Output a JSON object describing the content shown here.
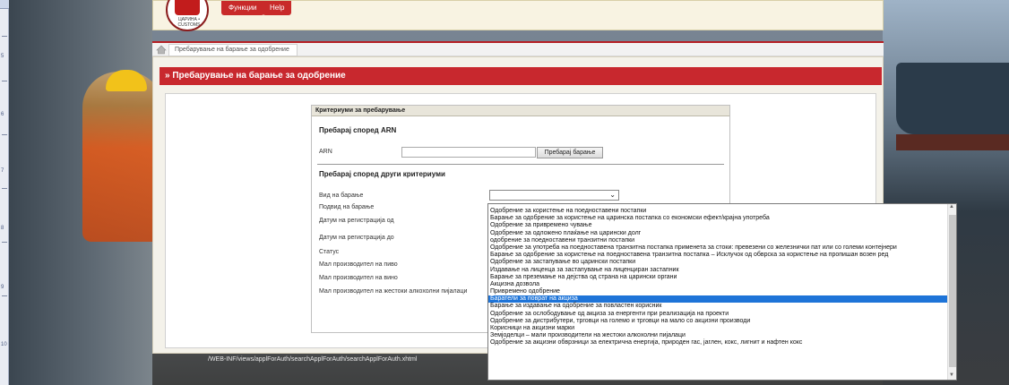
{
  "header": {
    "logo_text": "ЦАРИНА • CUSTOMS",
    "buttons": [
      "Функции",
      "Help"
    ]
  },
  "breadcrumb": {
    "current": "Пребарување на барање за одобрение"
  },
  "page_title": "» Пребарување на барање за одобрение",
  "form": {
    "header": "Критериуми за пребарување",
    "section_arn": "Пребарај според ARN",
    "arn_label": "ARN",
    "arn_value": "",
    "arn_button": "Пребарај барање",
    "section_other": "Пребарај според други критериуми",
    "fields": [
      "Вид на барање",
      "Подвид на барање",
      "Датум на регистрација од",
      "Датум на регистрација до",
      "Статус",
      "Мал производител на пиво",
      "Мал производител на вино",
      "Мал производител на жестоки алкохолни пијалаци"
    ],
    "select_value": ""
  },
  "dropdown": {
    "selected_index": 13,
    "options": [
      "Одобрение за користење на поедноставени постапки",
      "Барање за одобрение за користење на царинска постапка со економски ефект/крајна употреба",
      "Одобрение за привремено чување",
      "Одобрение за одложено плаќање на царински долг",
      "одобрение за поедноставени транзитни постапки",
      "Одобрение за употреба на поедноставена транзитна постапка применета за стоки: превезени со железнички пат или со големи контејнери",
      "Барање за одобрение за користење на поедноставена транзитна постапка – Исклучок од обврска за користење на пропишан возен ред",
      "Одобрение за застапување во царински постапки",
      "Издавање на лиценца за застапување на лиценциран застапник",
      "Барање за преземање на дејства од страна на царински органи",
      "Акцизна дозвола",
      "Привремено одобрение",
      "Баратели за поврат на акциза",
      "Барање за издавање на одобрение за повластен корисник",
      "Одобрение за ослободување од акциза за енергенти при реализација на проекти",
      "Одобрение за дистрибутери, трговци на големо и трговци на мало со акцизни производи",
      "Корисници на акцизни марки",
      "Земјоделци – мали производители на жестоки алкохолни пијалаци",
      "Одобрение за акцизни обврзници за електрична енергија, природен гас, јаглен, кокс, лигнит и нафтен кокс"
    ]
  },
  "footer": {
    "path": "/WEB-INF/views/applForAuth/searchApplForAuth/searchApplForAuth.xhtml"
  },
  "ruler": {
    "numbers": [
      "5",
      "6",
      "7",
      "8",
      "9",
      "10"
    ]
  }
}
